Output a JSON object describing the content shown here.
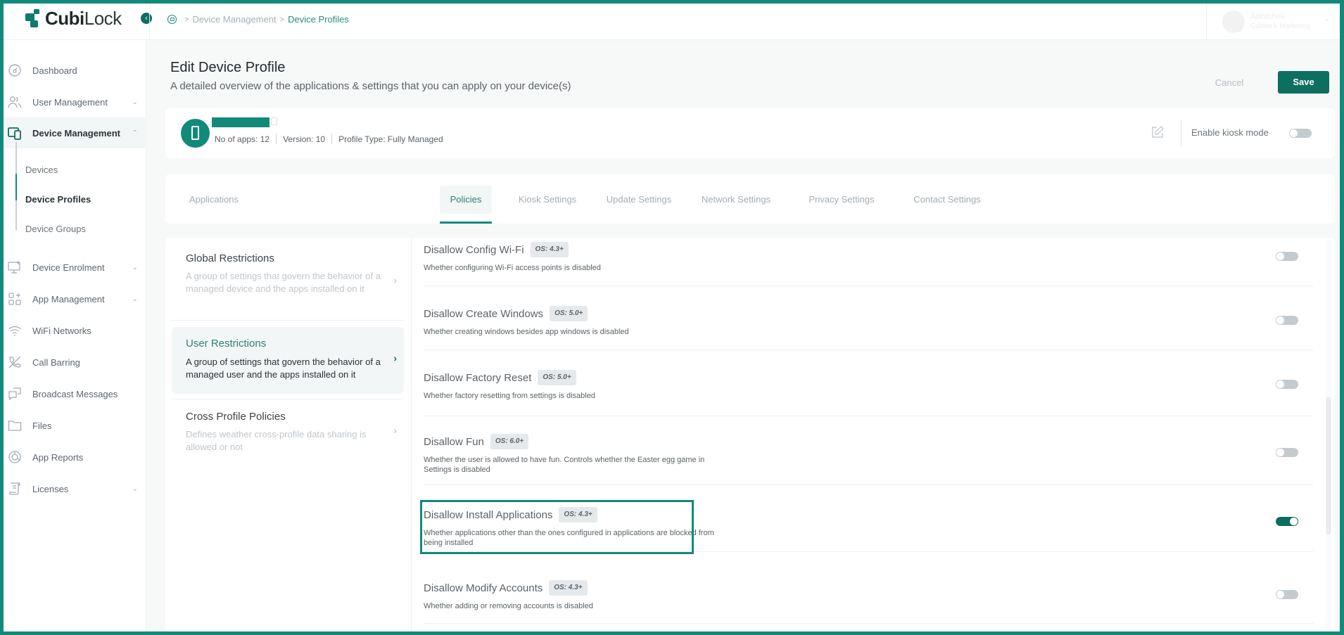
{
  "app": {
    "brand_bold": "Cubi",
    "brand_light": "Lock"
  },
  "breadcrumb": [
    "Device Management",
    "Device Profiles"
  ],
  "user": {
    "name": "Abhishek",
    "role": "Cubilock Marketing"
  },
  "sidebar": {
    "items": [
      {
        "label": "Dashboard",
        "icon": "dashboard-icon",
        "expandable": false
      },
      {
        "label": "User Management",
        "icon": "users-icon",
        "expandable": true
      },
      {
        "label": "Device Management",
        "icon": "devices-icon",
        "expandable": true,
        "expanded": true,
        "active": true
      },
      {
        "label": "Device Enrolment",
        "icon": "monitor-plus-icon",
        "expandable": true
      },
      {
        "label": "App Management",
        "icon": "apps-grid-icon",
        "expandable": true
      },
      {
        "label": "WiFi Networks",
        "icon": "wifi-icon",
        "expandable": false
      },
      {
        "label": "Call Barring",
        "icon": "phone-barred-icon",
        "expandable": false
      },
      {
        "label": "Broadcast Messages",
        "icon": "chat-icon",
        "expandable": false
      },
      {
        "label": "Files",
        "icon": "folder-icon",
        "expandable": false
      },
      {
        "label": "App Reports",
        "icon": "pie-chart-icon",
        "expandable": false
      },
      {
        "label": "Licenses",
        "icon": "license-icon",
        "expandable": true
      }
    ],
    "subitems": [
      {
        "label": "Devices"
      },
      {
        "label": "Device Profiles",
        "active": true
      },
      {
        "label": "Device Groups"
      }
    ]
  },
  "page": {
    "title": "Edit Device Profile",
    "subtitle": "A detailed overview of the applications & settings that you can apply on your device(s)",
    "cancel_label": "Cancel",
    "save_label": "Save"
  },
  "profile": {
    "apps": "No of apps: 12",
    "version": "Version: 10",
    "type": "Profile Type: Fully Managed",
    "kiosk_label": "Enable kiosk mode",
    "kiosk_enabled": false
  },
  "tabs": [
    {
      "label": "Applications"
    },
    {
      "label": "Policies",
      "active": true
    },
    {
      "label": "Kiosk Settings"
    },
    {
      "label": "Update Settings"
    },
    {
      "label": "Network Settings"
    },
    {
      "label": "Privacy Settings"
    },
    {
      "label": "Contact Settings"
    }
  ],
  "categories": [
    {
      "title": "Global Restrictions",
      "desc": "A group of settings that govern the behavior of a managed device and the apps installed on it"
    },
    {
      "title": "User Restrictions",
      "desc": "A group of settings that govern the behavior of a managed user and the apps installed on it",
      "active": true
    },
    {
      "title": "Cross Profile Policies",
      "desc": "Defines weather cross-profile data sharing is allowed or not"
    }
  ],
  "policies": [
    {
      "name": "Disallow Config Wi-Fi",
      "os": "OS: 4.3+",
      "desc": "Whether configuring Wi-Fi access points is disabled",
      "enabled": false
    },
    {
      "name": "Disallow Create Windows",
      "os": "OS: 5.0+",
      "desc": "Whether creating windows besides app windows is disabled",
      "enabled": false
    },
    {
      "name": "Disallow Factory Reset",
      "os": "OS: 5.0+",
      "desc": "Whether factory resetting from settings is disabled",
      "enabled": false
    },
    {
      "name": "Disallow Fun",
      "os": "OS: 6.0+",
      "desc": "Whether the user is allowed to have fun. Controls whether the Easter egg game in Settings is disabled",
      "enabled": false
    },
    {
      "name": "Disallow Install Applications",
      "os": "OS: 4.3+",
      "desc": "Whether applications other than the ones configured in applications are blocked from being installed",
      "enabled": true,
      "highlighted": true
    },
    {
      "name": "Disallow Modify Accounts",
      "os": "OS: 4.3+",
      "desc": "Whether adding or removing accounts is disabled",
      "enabled": false
    }
  ],
  "colors": {
    "accent": "#128a7a",
    "primary_button": "#0d6f5f",
    "toggle_off": "#c3cbd1",
    "toggle_on": "#0c6e5e"
  }
}
